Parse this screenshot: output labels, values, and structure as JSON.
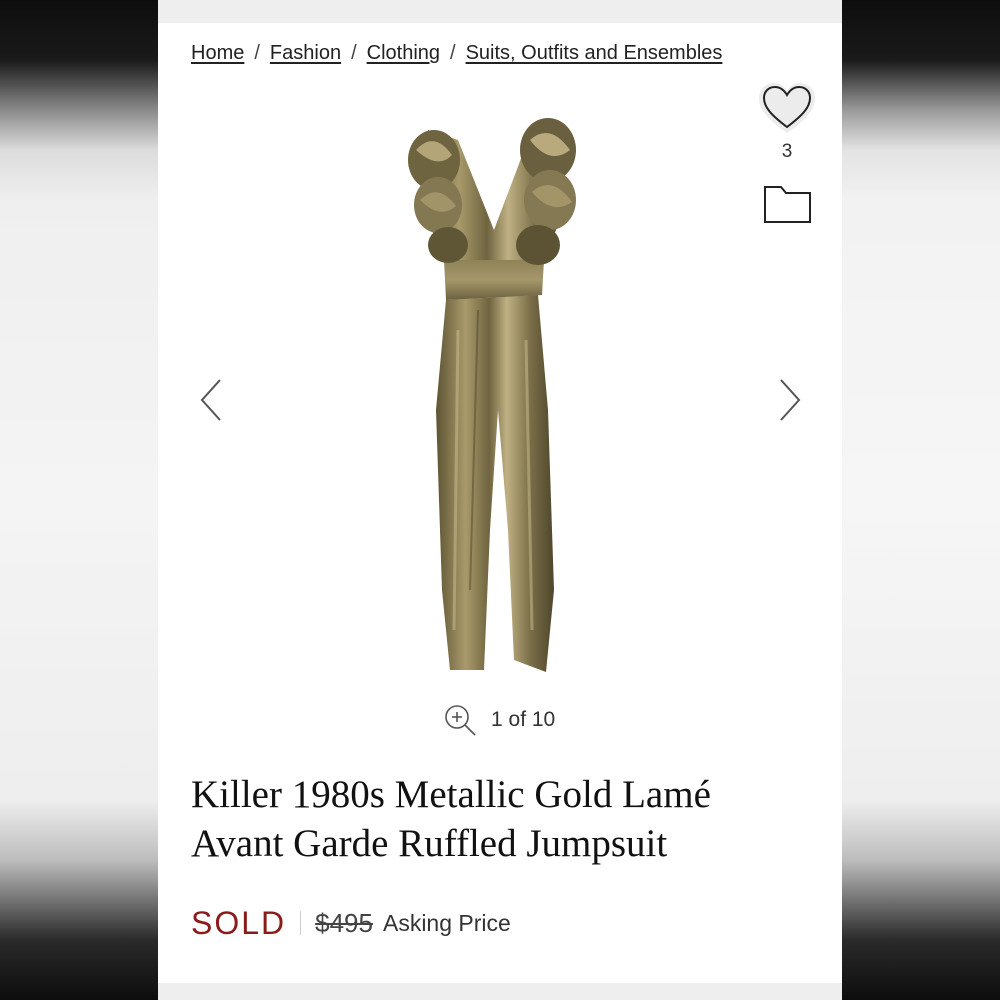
{
  "breadcrumb": {
    "items": [
      "Home",
      "Fashion",
      "Clothing",
      "Suits, Outfits and Ensembles"
    ],
    "separator": "/"
  },
  "actions": {
    "favorite_count": "3",
    "favorite_icon": "heart-icon",
    "save_icon": "folder-icon"
  },
  "gallery": {
    "prev_icon": "chevron-left-icon",
    "next_icon": "chevron-right-icon",
    "zoom_icon": "zoom-in-icon",
    "counter": "1 of 10"
  },
  "product": {
    "title_line1": "Killer 1980s Metallic Gold Lamé",
    "title_line2": "Avant Garde Ruffled Jumpsuit",
    "status": "SOLD",
    "price": "$495",
    "price_label": "Asking Price"
  },
  "colors": {
    "sold": "#8b1a1a",
    "text": "#111111",
    "gold_fabric": "#8a7c4e"
  }
}
